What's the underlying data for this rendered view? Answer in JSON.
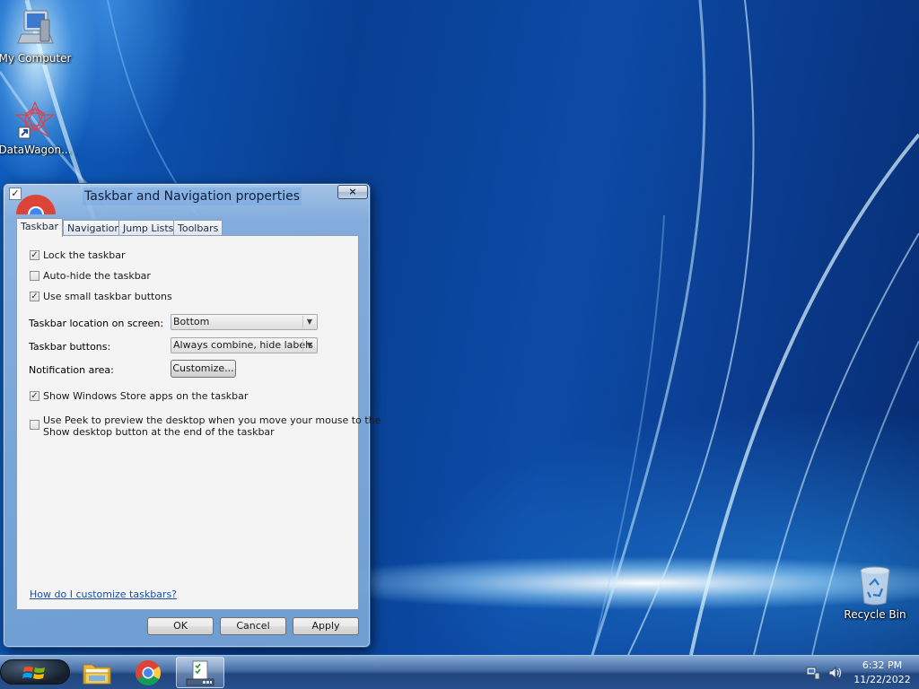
{
  "desktop": {
    "icons": [
      {
        "label": "My Computer",
        "icon": "computer-icon"
      },
      {
        "label": "DataWagon...",
        "icon": "datawagon-shortcut-icon"
      },
      {
        "label": "Recycle Bin",
        "icon": "recycle-bin-icon"
      }
    ]
  },
  "dialog": {
    "title": "Taskbar and Navigation properties",
    "close_label": "×",
    "title_check": "✓",
    "tabs": [
      {
        "label": "Taskbar",
        "active": true
      },
      {
        "label": "Navigation",
        "active": false
      },
      {
        "label": "Jump Lists",
        "active": false
      },
      {
        "label": "Toolbars",
        "active": false
      }
    ],
    "options": {
      "lock_taskbar": {
        "label": "Lock the taskbar",
        "checked": true
      },
      "auto_hide": {
        "label": "Auto-hide the taskbar",
        "checked": false
      },
      "small_buttons": {
        "label": "Use small taskbar buttons",
        "checked": true
      },
      "store_apps": {
        "label": "Show Windows Store apps on the taskbar",
        "checked": true
      },
      "peek": {
        "label_line1": "Use Peek to preview the desktop when you move your mouse to the",
        "label_line2": "Show desktop button at the end of the taskbar",
        "checked": false
      }
    },
    "check_glyph": "✓",
    "location": {
      "label": "Taskbar location on screen:",
      "value": "Bottom"
    },
    "buttons_mode": {
      "label": "Taskbar buttons:",
      "value": "Always combine, hide labels"
    },
    "notification": {
      "label": "Notification area:",
      "button_label": "Customize..."
    },
    "help_link": "How do I customize taskbars?",
    "footer": {
      "ok": "OK",
      "cancel": "Cancel",
      "apply": "Apply"
    }
  },
  "taskbar": {
    "start_icon": "windows-logo-icon",
    "pinned": [
      {
        "name": "explorer",
        "icon": "folder-icon"
      },
      {
        "name": "chrome",
        "icon": "chrome-icon"
      },
      {
        "name": "taskbar-properties",
        "icon": "taskbar-properties-icon",
        "active": true
      }
    ],
    "tray": {
      "network_icon": "network-icon",
      "volume_icon": "volume-icon",
      "time": "6:32 PM",
      "date": "11/22/2022"
    }
  }
}
